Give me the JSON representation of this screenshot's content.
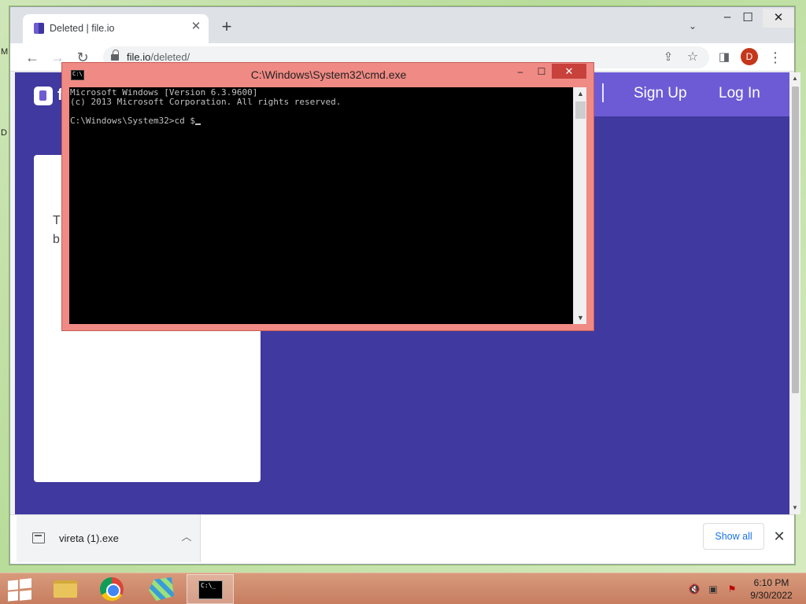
{
  "desktop": {
    "edge_letters": [
      "M",
      "D"
    ]
  },
  "browser": {
    "tab": {
      "title": "Deleted | file.io",
      "close": "✕"
    },
    "new_tab": "+",
    "window_controls": {
      "minimize": "–",
      "maximize": "☐",
      "close": "✕"
    },
    "url": {
      "host": "file.io",
      "path": "/deleted/"
    },
    "avatar_letter": "D",
    "site": {
      "logo_text": "f",
      "nav": {
        "signup": "Sign Up",
        "login": "Log In"
      },
      "card_text_lines": [
        "T",
        "b"
      ]
    },
    "downloads": {
      "file_name": "vireta (1).exe",
      "show_all": "Show all"
    }
  },
  "cmd": {
    "title": "C:\\Windows\\System32\\cmd.exe",
    "lines": [
      "Microsoft Windows [Version 6.3.9600]",
      "(c) 2013 Microsoft Corporation. All rights reserved.",
      "",
      "C:\\Windows\\System32>cd $"
    ]
  },
  "taskbar": {
    "apps": [
      "file-explorer",
      "google-chrome",
      "registry-editor",
      "command-prompt"
    ],
    "clock": {
      "time": "6:10 PM",
      "date": "9/30/2022"
    }
  },
  "colors": {
    "site_bg": "#3f39a0",
    "site_nav": "#6d5bd5",
    "cmd_frame": "#f08a84",
    "cmd_close": "#c8413b",
    "taskbar": "#c77d60"
  }
}
